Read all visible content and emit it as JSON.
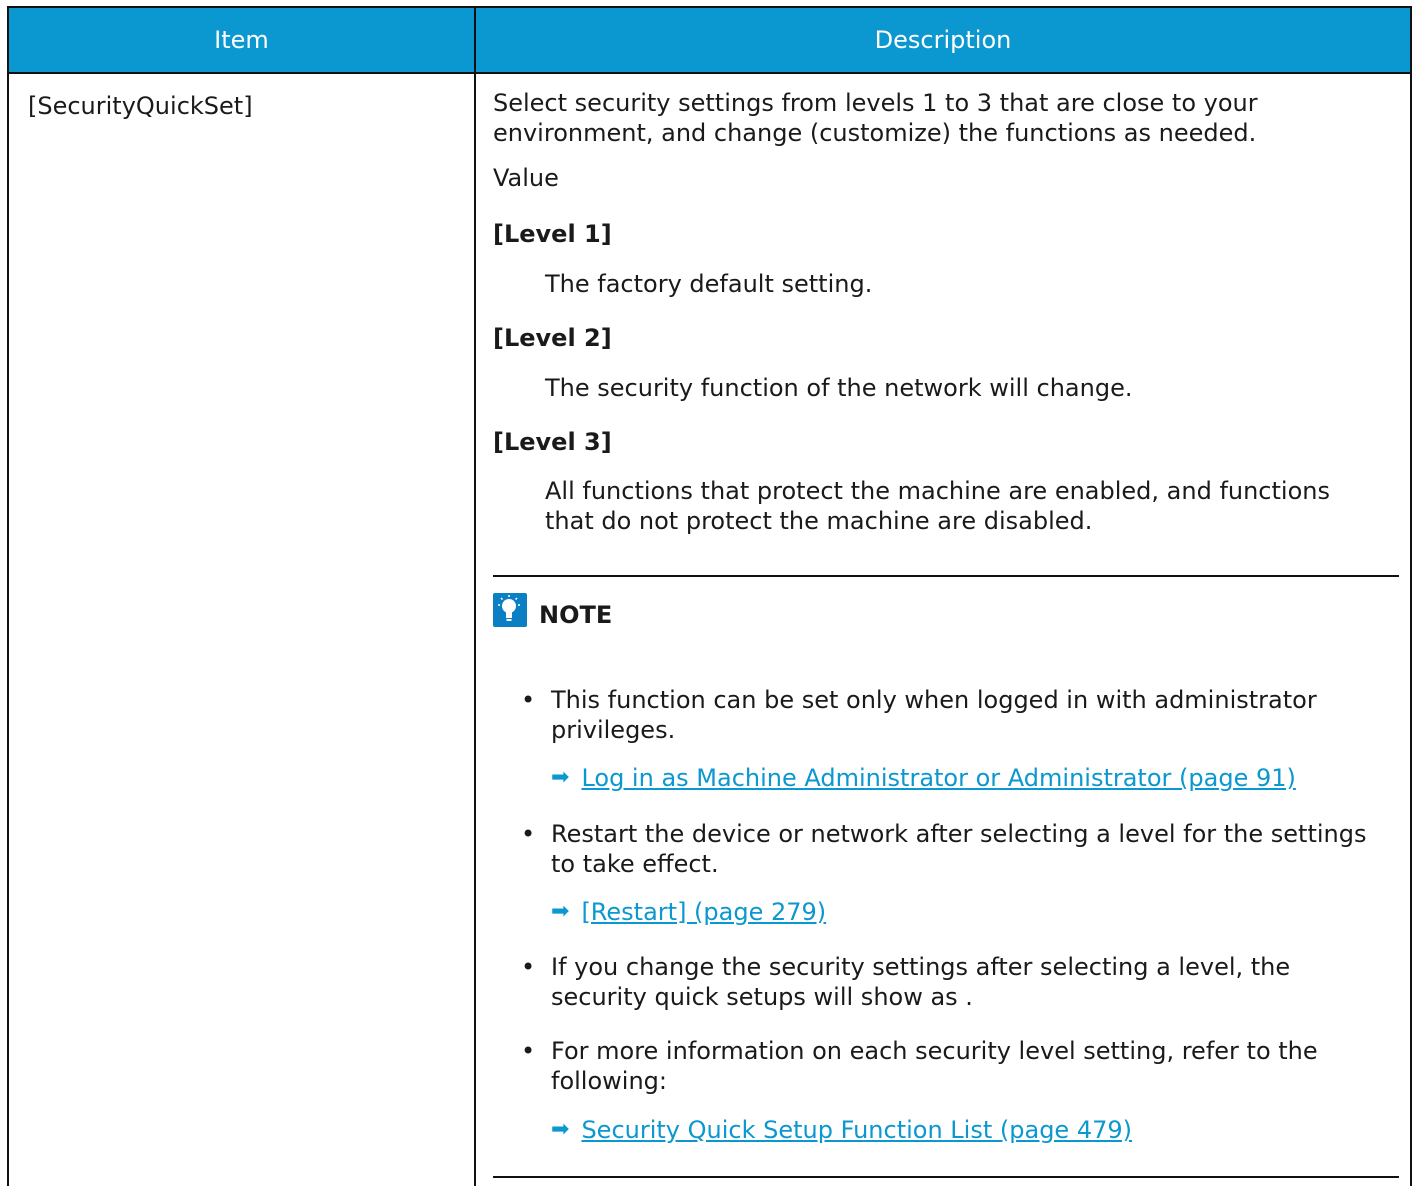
{
  "table": {
    "header": {
      "item": "Item",
      "description": "Description"
    },
    "row": {
      "item": "[SecurityQuickSet]",
      "intro": "Select security settings from levels 1 to 3 that are close to your environment, and change (customize) the functions as needed.",
      "value_label": "Value",
      "levels": [
        {
          "label": "[Level 1]",
          "text": "The factory default setting."
        },
        {
          "label": "[Level 2]",
          "text": "The security function of the network will change."
        },
        {
          "label": "[Level 3]",
          "text": "All functions that protect the machine are enabled, and functions that do not protect the machine are disabled."
        }
      ],
      "note": {
        "icon": "lightbulb-icon",
        "title": "NOTE",
        "bullets": [
          {
            "text": "This function can be set only when logged in with administrator privileges.",
            "link": "Log in as Machine Administrator or Administrator (page 91)"
          },
          {
            "text": "Restart the device or network after selecting a level for the settings to take effect.",
            "link": "[Restart] (page 279)"
          },
          {
            "text": "If you change the security settings after selecting a level, the security quick setups will show as .",
            "link": null
          },
          {
            "text": "For more information on each security level setting, refer to the following:",
            "link": "Security Quick Setup Function List (page 479)"
          }
        ]
      }
    }
  },
  "colors": {
    "header_bg": "#0b97cf",
    "link": "#0b97cf",
    "note_icon_bg": "#0b7fc4"
  }
}
